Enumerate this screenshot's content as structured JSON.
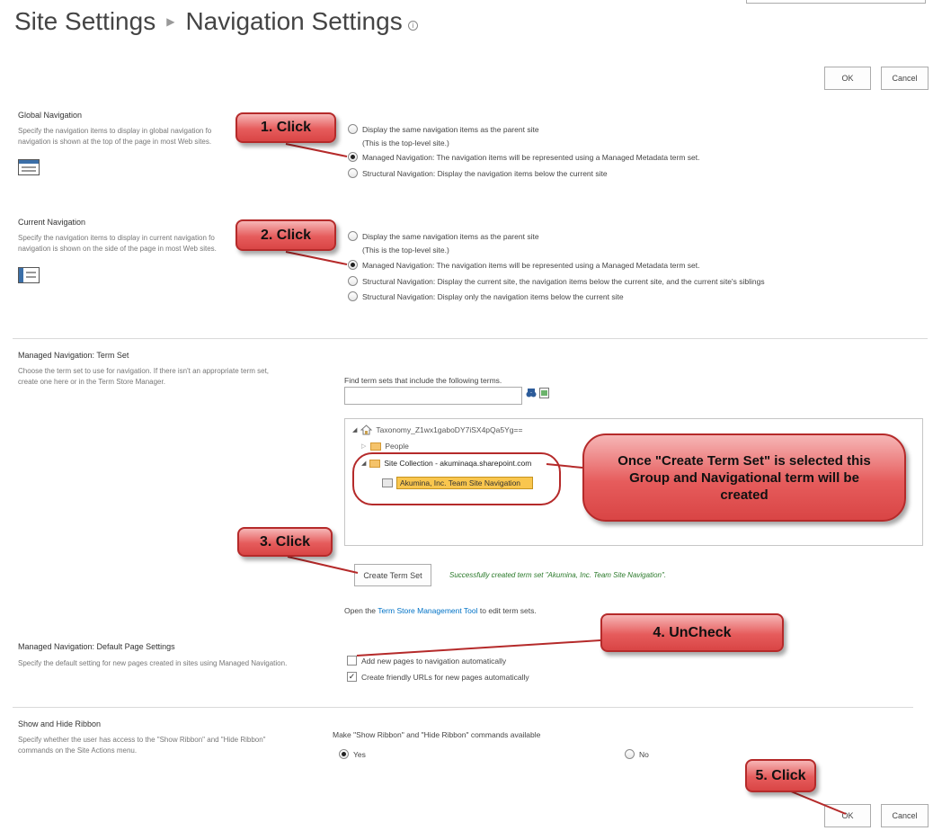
{
  "header": {
    "breadcrumb_root": "Site Settings",
    "page_title": "Navigation Settings"
  },
  "buttons": {
    "ok": "OK",
    "cancel": "Cancel",
    "create_term_set": "Create Term Set"
  },
  "global_nav": {
    "title": "Global Navigation",
    "desc_line1": "Specify the navigation items to display in global navigation fo",
    "desc_line2": "navigation is shown at the top of the page in most Web sites.",
    "options": [
      {
        "label": "Display the same navigation items as the parent site",
        "checked": false
      },
      {
        "label": "Managed Navigation: The navigation items will be represented using a Managed Metadata term set.",
        "checked": true
      },
      {
        "label": "Structural Navigation: Display the navigation items below the current site",
        "checked": false
      }
    ],
    "sub_note": "(This is the top-level site.)"
  },
  "current_nav": {
    "title": "Current Navigation",
    "desc_line1": "Specify the navigation items to display in current navigation fo",
    "desc_line2": "navigation is shown on the side of the page in most Web sites.",
    "options": [
      {
        "label": "Display the same navigation items as the parent site",
        "checked": false
      },
      {
        "label": "Managed Navigation: The navigation items will be represented using a Managed Metadata term set.",
        "checked": true
      },
      {
        "label": "Structural Navigation: Display the current site, the navigation items below the current site, and the current site's siblings",
        "checked": false
      },
      {
        "label": "Structural Navigation: Display only the navigation items below the current site",
        "checked": false
      }
    ],
    "sub_note": "(This is the top-level site.)"
  },
  "term_set": {
    "title": "Managed Navigation: Term Set",
    "desc_line1": "Choose the term set to use for navigation. If there isn't an appropriate term set,",
    "desc_line2": "create one here or in the Term Store Manager.",
    "find_label": "Find term sets that include the following terms.",
    "find_value": "",
    "tree": {
      "root": "Taxonomy_Z1wx1gaboDY7iSX4pQa5Yg==",
      "people": "People",
      "site_collection": "Site Collection - akuminaqa.sharepoint.com",
      "term": "Akumina, Inc. Team Site Navigation"
    },
    "success_msg": "Successfully created term set \"Akumina, Inc. Team Site Navigation\".",
    "open_prefix": "Open the ",
    "open_link": "Term Store Management Tool",
    "open_suffix": " to edit term sets."
  },
  "default_page": {
    "title": "Managed Navigation: Default Page Settings",
    "desc": "Specify the default setting for new pages created in sites using Managed Navigation.",
    "options": [
      {
        "label": "Add new pages to navigation automatically",
        "checked": false
      },
      {
        "label": "Create friendly URLs for new pages automatically",
        "checked": true
      }
    ]
  },
  "ribbon": {
    "title": "Show and Hide Ribbon",
    "desc_line1": "Specify whether the user has access to the \"Show Ribbon\" and \"Hide Ribbon\"",
    "desc_line2": "commands on the Site Actions menu.",
    "question": "Make \"Show Ribbon\" and \"Hide Ribbon\" commands available",
    "yes": "Yes",
    "no": "No",
    "selected": "Yes"
  },
  "callouts": {
    "c1": "1. Click",
    "c2": "2. Click",
    "c3": "3. Click",
    "c4": "4. UnCheck",
    "c5": "5. Click",
    "big_line1": "Once \"Create Term Set\" is selected this",
    "big_line2": "Group and Navigational term will be",
    "big_line3": "created"
  },
  "colors": {
    "callout_fill": "#e65c5c",
    "callout_border": "#b52a2a",
    "link": "#0072c6",
    "highlight": "#f9c64e"
  }
}
